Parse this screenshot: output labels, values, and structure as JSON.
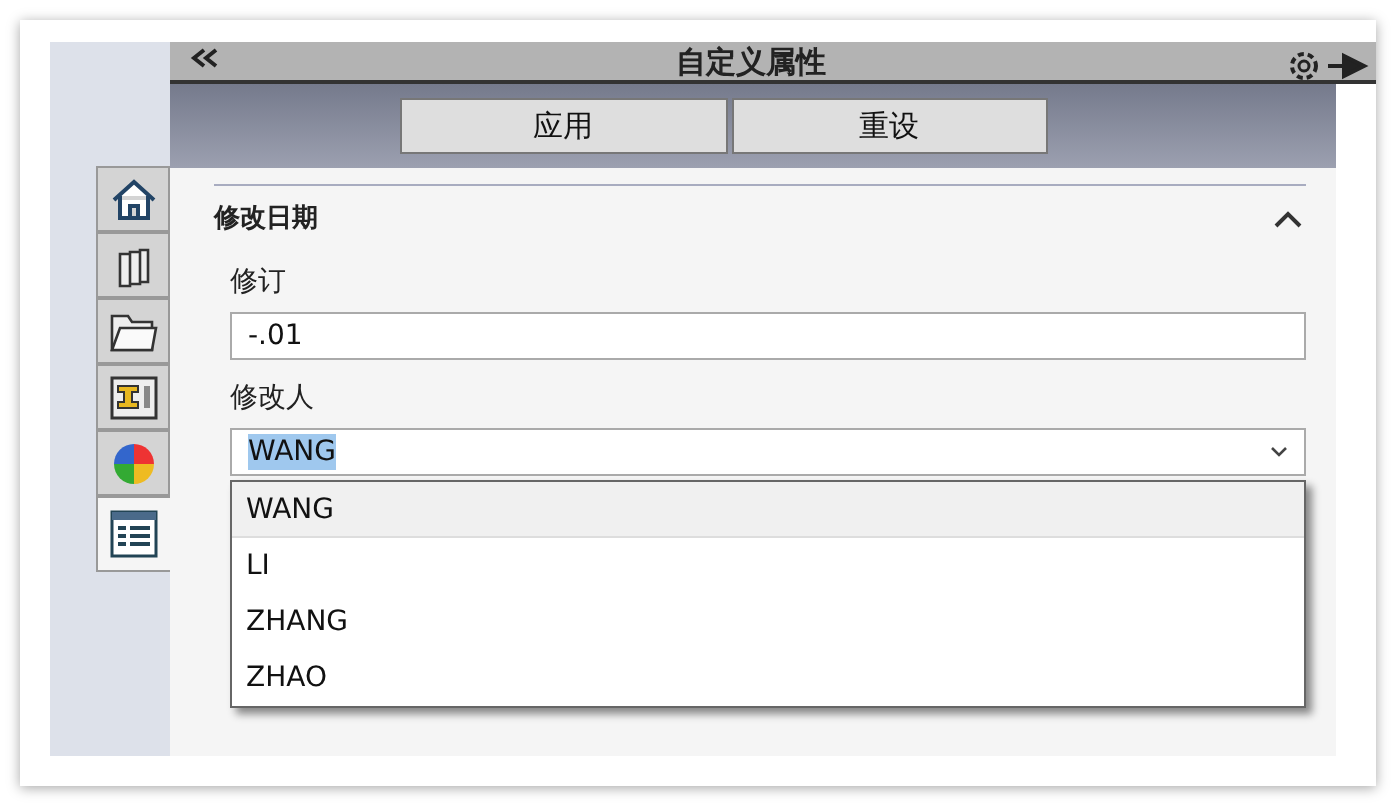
{
  "panel": {
    "title": "自定义属性"
  },
  "buttons": [
    "应用",
    "重设"
  ],
  "side_tabs": [
    {
      "kind": "home",
      "selected": false
    },
    {
      "kind": "books",
      "selected": false
    },
    {
      "kind": "folder",
      "selected": false
    },
    {
      "kind": "layout",
      "selected": false
    },
    {
      "kind": "appearance",
      "selected": false
    },
    {
      "kind": "properties",
      "selected": true
    }
  ],
  "section": {
    "title": "修改日期",
    "expanded": true
  },
  "fields": [
    {
      "kind": "text",
      "label": "修订",
      "value": "-.01"
    },
    {
      "kind": "combo",
      "label": "修改人",
      "value": "WANG",
      "value_highlighted": true,
      "open": true,
      "options": [
        {
          "label": "WANG",
          "selected": true
        },
        {
          "label": "LI",
          "selected": false
        },
        {
          "label": "ZHANG",
          "selected": false
        },
        {
          "label": "ZHAO",
          "selected": false
        }
      ]
    }
  ]
}
